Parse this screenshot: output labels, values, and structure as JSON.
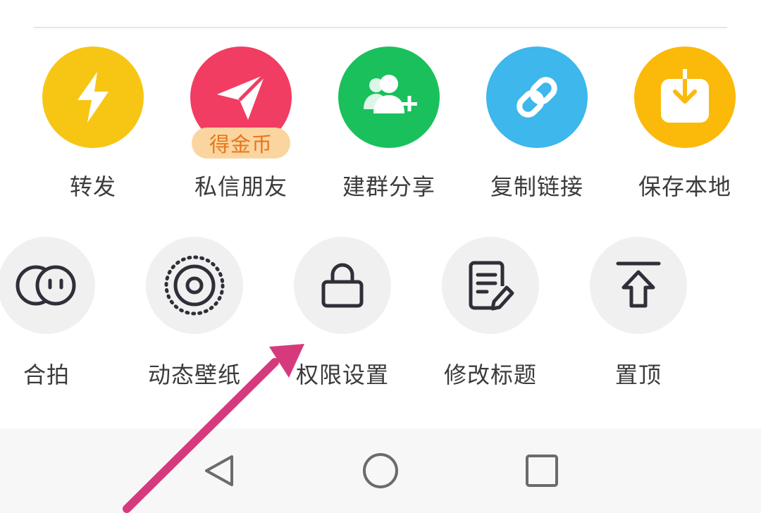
{
  "share_row": [
    {
      "label": "转发",
      "icon": "lightning-icon",
      "color": "#f7c614"
    },
    {
      "label": "私信朋友",
      "icon": "paper-plane-icon",
      "color": "#f23d63",
      "badge": "得金币"
    },
    {
      "label": "建群分享",
      "icon": "add-group-icon",
      "color": "#1ac05c"
    },
    {
      "label": "复制链接",
      "icon": "link-icon",
      "color": "#3db7ec"
    },
    {
      "label": "保存本地",
      "icon": "download-icon",
      "color": "#fbb90a"
    }
  ],
  "action_row": [
    {
      "label": "合拍",
      "icon": "duet-icon"
    },
    {
      "label": "动态壁纸",
      "icon": "live-wallpaper-icon"
    },
    {
      "label": "权限设置",
      "icon": "lock-icon"
    },
    {
      "label": "修改标题",
      "icon": "edit-title-icon"
    },
    {
      "label": "置顶",
      "icon": "pin-top-icon"
    }
  ],
  "navigation": {
    "back": "back-triangle-icon",
    "home": "home-circle-icon",
    "recents": "recents-square-icon"
  },
  "annotation": {
    "arrow_color": "#d63a7c",
    "target": "权限设置"
  }
}
